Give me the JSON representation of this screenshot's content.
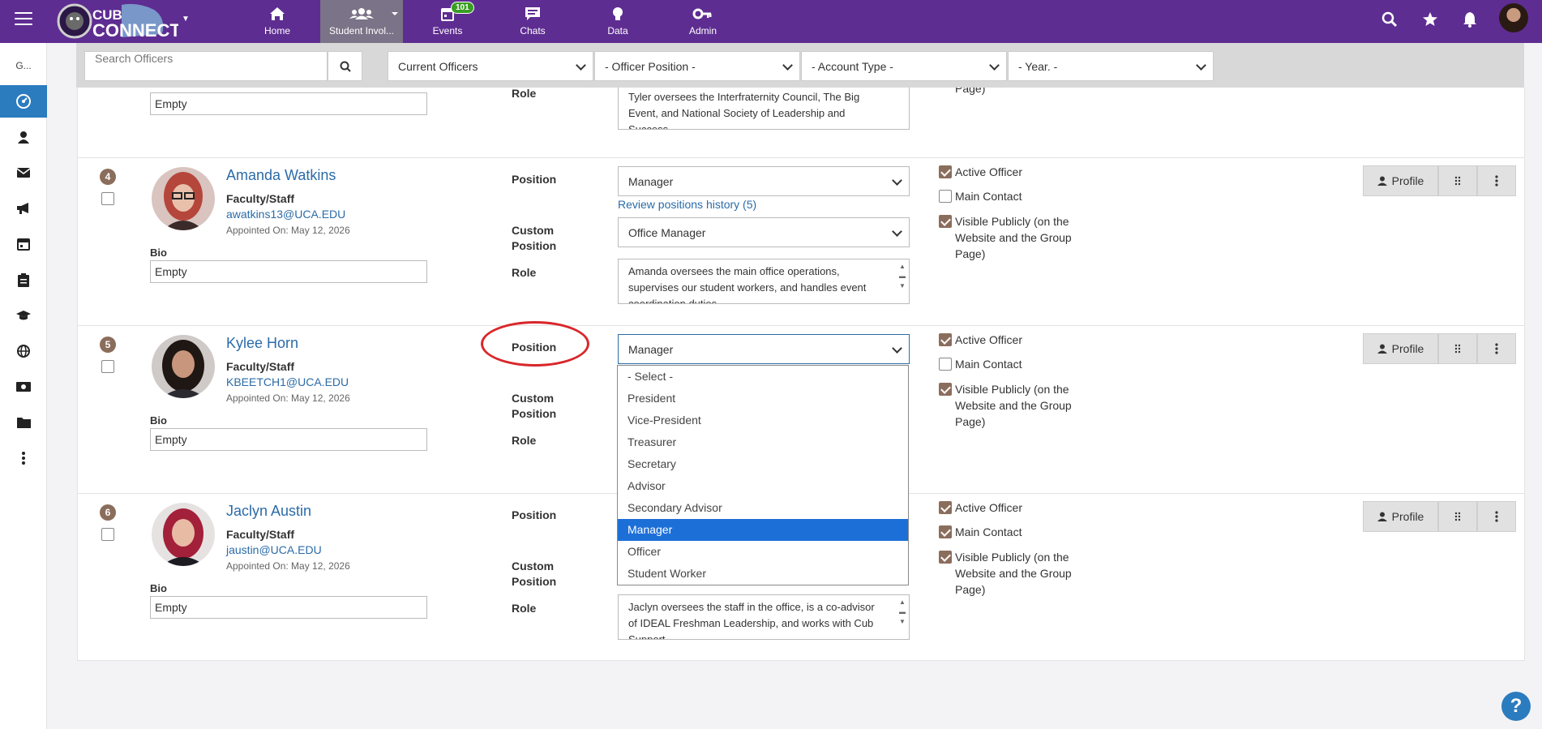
{
  "topbar": {
    "logo_text": "CUB CONNECT",
    "nav": [
      {
        "label": "Home",
        "icon": "home-icon"
      },
      {
        "label": "Student Invol...",
        "icon": "users-icon"
      },
      {
        "label": "Events",
        "icon": "calendar-icon",
        "badge": "101"
      },
      {
        "label": "Chats",
        "icon": "chat-icon"
      },
      {
        "label": "Data",
        "icon": "lightbulb-icon"
      },
      {
        "label": "Admin",
        "icon": "key-icon"
      }
    ]
  },
  "sidebar": {
    "top_text": "G..."
  },
  "filters": {
    "search_placeholder": "Search Officers",
    "status": "Current Officers",
    "position": "- Officer Position -",
    "account_type": "- Account Type -",
    "year": "- Year. -"
  },
  "partial_row": {
    "bio_label": "Bio",
    "bio_value": "Empty",
    "role_label": "Role",
    "role_text": "Tyler oversees the Interfraternity Council, The Big Event, and National Society of Leadership and Success.",
    "right_tail": "Page)"
  },
  "labels": {
    "position": "Position",
    "custom": "Custom",
    "position2": "Position",
    "role": "Role",
    "bio": "Bio",
    "active_officer": "Active Officer",
    "main_contact": "Main Contact",
    "visible_publicly": "Visible Publicly (on the Website and the Group Page)",
    "profile_button": "Profile",
    "review_history": "Review positions history (5)"
  },
  "officers": [
    {
      "number": "4",
      "name": "Amanda Watkins",
      "type": "Faculty/Staff",
      "email": "awatkins13@UCA.EDU",
      "appointed": "Appointed On: May 12, 2026",
      "bio": "Empty",
      "position": "Manager",
      "custom_position": "Office Manager",
      "role": "Amanda oversees the main office operations, supervises our student workers, and handles event coordination duties.",
      "active": true,
      "main_contact": false,
      "visible": true
    },
    {
      "number": "5",
      "name": "Kylee Horn",
      "type": "Faculty/Staff",
      "email": "KBEETCH1@UCA.EDU",
      "appointed": "Appointed On: May 12, 2026",
      "bio": "Empty",
      "position": "Manager",
      "active": true,
      "main_contact": false,
      "visible": true
    },
    {
      "number": "6",
      "name": "Jaclyn Austin",
      "type": "Faculty/Staff",
      "email": "jaustin@UCA.EDU",
      "appointed": "Appointed On: May 12, 2026",
      "bio": "Empty",
      "role": "Jaclyn oversees the staff in the office, is a co-advisor of IDEAL Freshman Leadership, and works with Cub Support.",
      "active": true,
      "main_contact": true,
      "visible": true
    }
  ],
  "dropdown": {
    "options": [
      "- Select -",
      "President",
      "Vice-President",
      "Treasurer",
      "Secretary",
      "Advisor",
      "Secondary Advisor",
      "Manager",
      "Officer",
      "Student Worker"
    ],
    "selected": "Manager"
  }
}
